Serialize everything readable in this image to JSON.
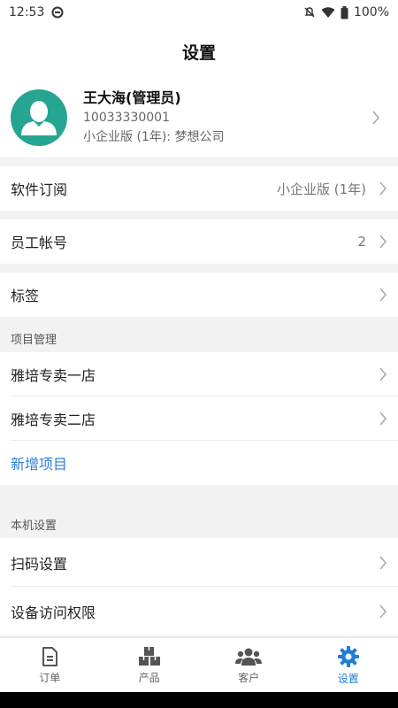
{
  "status": {
    "time": "12:53",
    "battery": "100%",
    "icons": [
      "sync-icon",
      "bell-off-icon",
      "wifi-icon",
      "battery-icon"
    ]
  },
  "header": {
    "title": "设置"
  },
  "profile": {
    "name": "王大海(管理员)",
    "phone": "10033330001",
    "plan": "小企业版 (1年): 梦想公司"
  },
  "rows": {
    "subscription": {
      "label": "软件订阅",
      "value": "小企业版 (1年)"
    },
    "staff": {
      "label": "员工帐号",
      "value": "2"
    },
    "tags": {
      "label": "标签"
    }
  },
  "projects": {
    "section_label": "项目管理",
    "items": [
      {
        "label": "雅培专卖一店"
      },
      {
        "label": "雅培专卖二店"
      }
    ],
    "add_label": "新增项目"
  },
  "device": {
    "section_label": "本机设置",
    "items": [
      {
        "label": "扫码设置"
      },
      {
        "label": "设备访问权限"
      }
    ]
  },
  "tabs": [
    {
      "label": "订单",
      "icon": "document-icon"
    },
    {
      "label": "产品",
      "icon": "boxes-icon"
    },
    {
      "label": "客户",
      "icon": "people-icon"
    },
    {
      "label": "设置",
      "icon": "gear-icon",
      "active": true
    }
  ],
  "colors": {
    "accent": "#1f7ed6",
    "avatar_bg": "#26a592",
    "link": "#2a7fd4"
  }
}
